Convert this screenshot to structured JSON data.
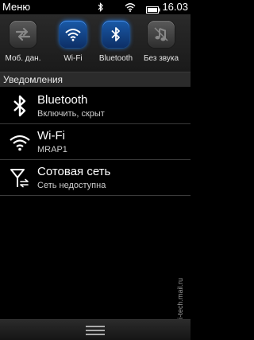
{
  "status_bar": {
    "menu_label": "Меню",
    "bluetooth_icon": "bluetooth-icon",
    "wifi_icon": "wifi-signal-icon",
    "battery_icon": "battery-icon",
    "time": "16.03"
  },
  "toggles": [
    {
      "label": "Моб. дан.",
      "icon": "mobile-data-icon",
      "state": "off"
    },
    {
      "label": "Wi-Fi",
      "icon": "wifi-icon",
      "state": "on"
    },
    {
      "label": "Bluetooth",
      "icon": "bluetooth-icon",
      "state": "on"
    },
    {
      "label": "Без звука",
      "icon": "silent-icon",
      "state": "off"
    }
  ],
  "section": {
    "title": "Уведомления"
  },
  "notifications": [
    {
      "title": "Bluetooth",
      "subtitle": "Включить, скрыт",
      "icon": "bluetooth-icon"
    },
    {
      "title": "Wi-Fi",
      "subtitle": "MRAP1",
      "icon": "wifi-icon"
    },
    {
      "title": "Сотовая сеть",
      "subtitle": "Сеть недоступна",
      "icon": "cellular-network-icon"
    }
  ],
  "watermark": "© hi-tech.mail.ru",
  "colors": {
    "accent": "#1a5aa8",
    "glow": "#2e7fe0",
    "background": "#000000",
    "panel": "#2b2b2b"
  }
}
